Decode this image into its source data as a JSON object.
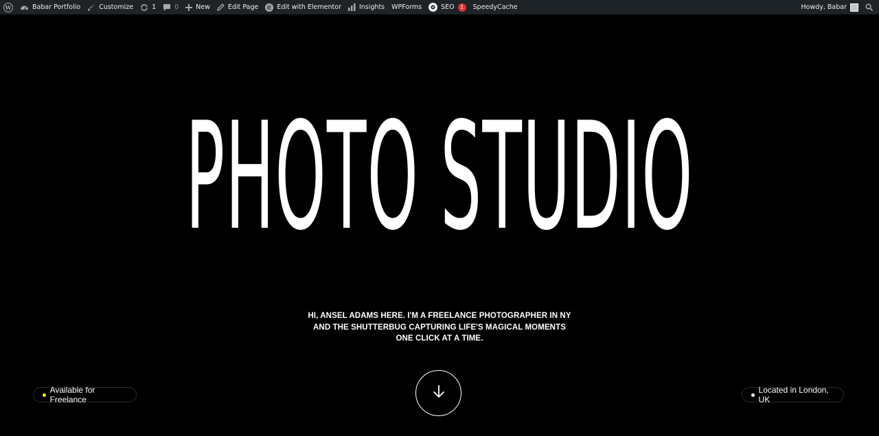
{
  "adminbar": {
    "site_name": "Babar Portfolio",
    "customize": "Customize",
    "updates_count": "1",
    "comments_count": "0",
    "new_label": "New",
    "edit_page": "Edit Page",
    "edit_elementor": "Edit with Elementor",
    "insights": "Insights",
    "wpforms": "WPForms",
    "seo": "SEO",
    "seo_badge": "1",
    "speedycache": "SpeedyCache",
    "howdy": "Howdy, Babar"
  },
  "hero": {
    "title": "PHOTO STUDIO",
    "intro_lines": [
      "HI, ANSEL ADAMS HERE. I'M A FREELANCE PHOTOGRAPHER IN NY",
      "AND THE SHUTTERBUG CAPTURING LIFE'S MAGICAL MOMENTS",
      "ONE CLICK AT A TIME."
    ],
    "availability": "Available for Freelance",
    "location": "Located in London, UK"
  },
  "colors": {
    "adminbar_bg": "#1d2327",
    "page_bg": "#000000",
    "available_dot": "#f5f500",
    "location_dot": "#ffffff",
    "badge_red": "#d63638"
  },
  "icons": {
    "wp_logo": "wordpress-icon",
    "dashboard": "dashboard-icon",
    "customize": "brush-icon",
    "updates": "refresh-icon",
    "comments": "comment-icon",
    "new": "plus-icon",
    "edit": "pencil-icon",
    "elementor": "elementor-icon",
    "insights": "bar-chart-icon",
    "seo": "seo-icon",
    "search": "search-icon",
    "scroll": "arrow-down-icon"
  }
}
